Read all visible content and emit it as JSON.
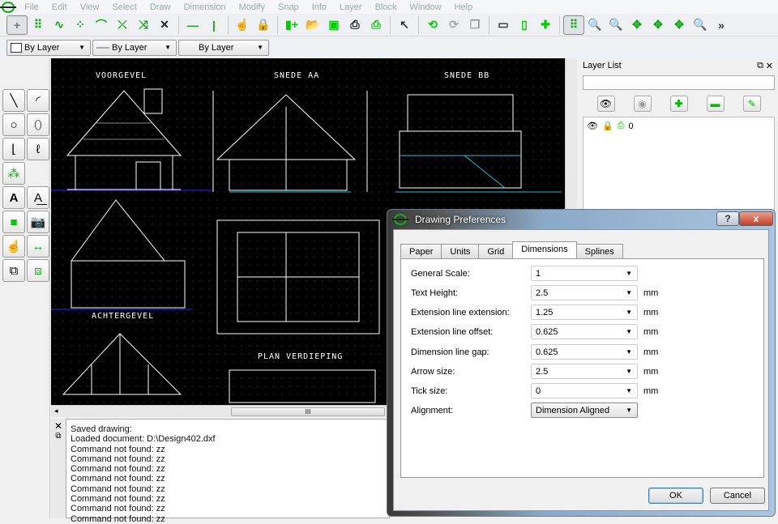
{
  "menu": [
    "File",
    "Edit",
    "View",
    "Select",
    "Draw",
    "Dimension",
    "Modify",
    "Snap",
    "Info",
    "Layer",
    "Block",
    "Window",
    "Help"
  ],
  "pen": {
    "color": "By Layer",
    "width": "By Layer",
    "type": "By Layer"
  },
  "drawing_labels": {
    "front": "VOORGEVEL",
    "section_aa": "SNEDE AA",
    "section_bb": "SNEDE BB",
    "rear": "ACHTERGEVEL",
    "floor_plan": "PLAN VERDIEPING"
  },
  "hscroll_grip": "III",
  "command_log": [
    "Saved drawing:",
    "Loaded document: D:\\Design402.dxf",
    "Command not found: zz",
    "Command not found: zz",
    "Command not found: zz",
    "Command not found: zz",
    "Command not found: zz",
    "Command not found: zz",
    "Command not found: zz",
    "Command not found: zz"
  ],
  "layer_list": {
    "title": "Layer List",
    "search_value": "",
    "layers": [
      {
        "name": "0"
      }
    ]
  },
  "dialog": {
    "title": "Drawing Preferences",
    "help": "?",
    "close": "x",
    "tabs": [
      "Paper",
      "Units",
      "Grid",
      "Dimensions",
      "Splines"
    ],
    "active_tab": "Dimensions",
    "fields": [
      {
        "label": "General Scale:",
        "value": "1",
        "unit": ""
      },
      {
        "label": "Text Height:",
        "value": "2.5",
        "unit": "mm"
      },
      {
        "label": "Extension line extension:",
        "value": "1.25",
        "unit": "mm"
      },
      {
        "label": "Extension line offset:",
        "value": "0.625",
        "unit": "mm"
      },
      {
        "label": "Dimension line gap:",
        "value": "0.625",
        "unit": "mm"
      },
      {
        "label": "Arrow size:",
        "value": "2.5",
        "unit": "mm"
      },
      {
        "label": "Tick size:",
        "value": "0",
        "unit": "mm"
      },
      {
        "label": "Alignment:",
        "value": "Dimension Aligned",
        "unit": ""
      }
    ],
    "ok": "OK",
    "cancel": "Cancel"
  }
}
